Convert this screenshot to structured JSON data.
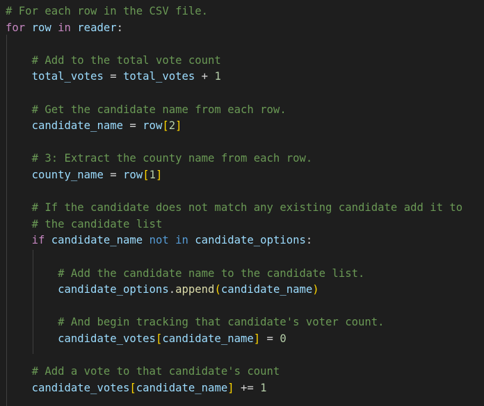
{
  "editor": {
    "lines": [
      {
        "tokens": [
          {
            "t": "# For each row in the CSV file.",
            "c": "cm"
          }
        ]
      },
      {
        "tokens": [
          {
            "t": "for",
            "c": "kw"
          },
          {
            "t": " ",
            "c": "op"
          },
          {
            "t": "row",
            "c": "var"
          },
          {
            "t": " ",
            "c": "op"
          },
          {
            "t": "in",
            "c": "kw"
          },
          {
            "t": " ",
            "c": "op"
          },
          {
            "t": "reader",
            "c": "var"
          },
          {
            "t": ":",
            "c": "op"
          }
        ]
      },
      {
        "tokens": []
      },
      {
        "tokens": [
          {
            "t": "    ",
            "c": "op"
          },
          {
            "t": "# Add to the total vote count",
            "c": "cm"
          }
        ]
      },
      {
        "tokens": [
          {
            "t": "    ",
            "c": "op"
          },
          {
            "t": "total_votes",
            "c": "var"
          },
          {
            "t": " = ",
            "c": "op"
          },
          {
            "t": "total_votes",
            "c": "var"
          },
          {
            "t": " + ",
            "c": "op"
          },
          {
            "t": "1",
            "c": "num"
          }
        ]
      },
      {
        "tokens": []
      },
      {
        "tokens": [
          {
            "t": "    ",
            "c": "op"
          },
          {
            "t": "# Get the candidate name from each row.",
            "c": "cm"
          }
        ]
      },
      {
        "tokens": [
          {
            "t": "    ",
            "c": "op"
          },
          {
            "t": "candidate_name",
            "c": "var"
          },
          {
            "t": " = ",
            "c": "op"
          },
          {
            "t": "row",
            "c": "var"
          },
          {
            "t": "[",
            "c": "b1"
          },
          {
            "t": "2",
            "c": "num"
          },
          {
            "t": "]",
            "c": "b1"
          }
        ]
      },
      {
        "tokens": []
      },
      {
        "tokens": [
          {
            "t": "    ",
            "c": "op"
          },
          {
            "t": "# 3: Extract the county name from each row.",
            "c": "cm"
          }
        ]
      },
      {
        "tokens": [
          {
            "t": "    ",
            "c": "op"
          },
          {
            "t": "county_name",
            "c": "var"
          },
          {
            "t": " = ",
            "c": "op"
          },
          {
            "t": "row",
            "c": "var"
          },
          {
            "t": "[",
            "c": "b1"
          },
          {
            "t": "1",
            "c": "num"
          },
          {
            "t": "]",
            "c": "b1"
          }
        ]
      },
      {
        "tokens": []
      },
      {
        "tokens": [
          {
            "t": "    ",
            "c": "op"
          },
          {
            "t": "# If the candidate does not match any existing candidate add it to",
            "c": "cm"
          }
        ]
      },
      {
        "tokens": [
          {
            "t": "    ",
            "c": "op"
          },
          {
            "t": "# the candidate list",
            "c": "cm"
          }
        ]
      },
      {
        "tokens": [
          {
            "t": "    ",
            "c": "op"
          },
          {
            "t": "if",
            "c": "kw"
          },
          {
            "t": " ",
            "c": "op"
          },
          {
            "t": "candidate_name",
            "c": "var"
          },
          {
            "t": " ",
            "c": "op"
          },
          {
            "t": "not",
            "c": "kw2"
          },
          {
            "t": " ",
            "c": "op"
          },
          {
            "t": "in",
            "c": "kw2"
          },
          {
            "t": " ",
            "c": "op"
          },
          {
            "t": "candidate_options",
            "c": "var"
          },
          {
            "t": ":",
            "c": "op"
          }
        ]
      },
      {
        "tokens": []
      },
      {
        "tokens": [
          {
            "t": "        ",
            "c": "op"
          },
          {
            "t": "# Add the candidate name to the candidate list.",
            "c": "cm"
          }
        ]
      },
      {
        "tokens": [
          {
            "t": "        ",
            "c": "op"
          },
          {
            "t": "candidate_options",
            "c": "var"
          },
          {
            "t": ".",
            "c": "op"
          },
          {
            "t": "append",
            "c": "fn"
          },
          {
            "t": "(",
            "c": "b1"
          },
          {
            "t": "candidate_name",
            "c": "var"
          },
          {
            "t": ")",
            "c": "b1"
          }
        ]
      },
      {
        "tokens": []
      },
      {
        "tokens": [
          {
            "t": "        ",
            "c": "op"
          },
          {
            "t": "# And begin tracking that candidate's voter count.",
            "c": "cm"
          }
        ]
      },
      {
        "tokens": [
          {
            "t": "        ",
            "c": "op"
          },
          {
            "t": "candidate_votes",
            "c": "var"
          },
          {
            "t": "[",
            "c": "b1"
          },
          {
            "t": "candidate_name",
            "c": "var"
          },
          {
            "t": "]",
            "c": "b1"
          },
          {
            "t": " = ",
            "c": "op"
          },
          {
            "t": "0",
            "c": "num"
          }
        ]
      },
      {
        "tokens": []
      },
      {
        "tokens": [
          {
            "t": "    ",
            "c": "op"
          },
          {
            "t": "# Add a vote to that candidate's count",
            "c": "cm"
          }
        ]
      },
      {
        "tokens": [
          {
            "t": "    ",
            "c": "op"
          },
          {
            "t": "candidate_votes",
            "c": "var"
          },
          {
            "t": "[",
            "c": "b1"
          },
          {
            "t": "candidate_name",
            "c": "var"
          },
          {
            "t": "]",
            "c": "b1"
          },
          {
            "t": " += ",
            "c": "op"
          },
          {
            "t": "1",
            "c": "num"
          }
        ]
      }
    ]
  },
  "colors": {
    "background": "#1e1e1e",
    "comment": "#6a9955",
    "keyword": "#c586c0",
    "keyword_operator": "#569cd6",
    "variable": "#9cdcfe",
    "function": "#dcdcaa",
    "number": "#b5cea8",
    "bracket": "#ffd700",
    "indent_guide": "#404040"
  }
}
